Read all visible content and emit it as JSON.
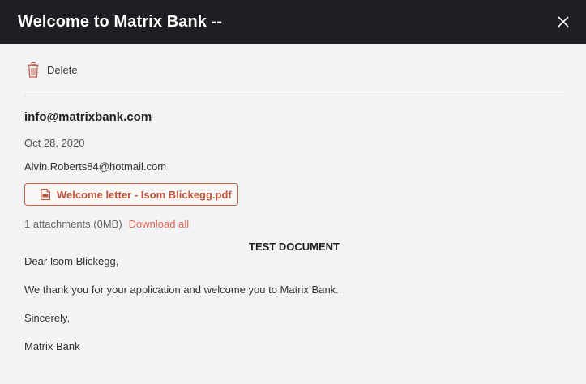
{
  "header": {
    "title": "Welcome to Matrix Bank --"
  },
  "toolbar": {
    "delete_label": "Delete"
  },
  "email": {
    "from": "info@matrixbank.com",
    "date": "Oct 28, 2020",
    "to": "Alvin.Roberts84@hotmail.com",
    "attachment": {
      "name": "Welcome letter - Isom Blickegg.pdf",
      "icon": "pdf-file-icon"
    },
    "attachments_info": "1 attachments (0MB)",
    "download_all_label": "Download all",
    "body": {
      "title": "TEST DOCUMENT",
      "greeting": "Dear Isom Blickegg,",
      "paragraph": "We thank you for your application and welcome you to Matrix Bank.",
      "closing": "Sincerely,",
      "signature": "Matrix Bank"
    }
  },
  "colors": {
    "header_bg": "#1e1f22",
    "accent": "#c9654f",
    "link": "#e06b55",
    "background": "#f3f2f4"
  }
}
